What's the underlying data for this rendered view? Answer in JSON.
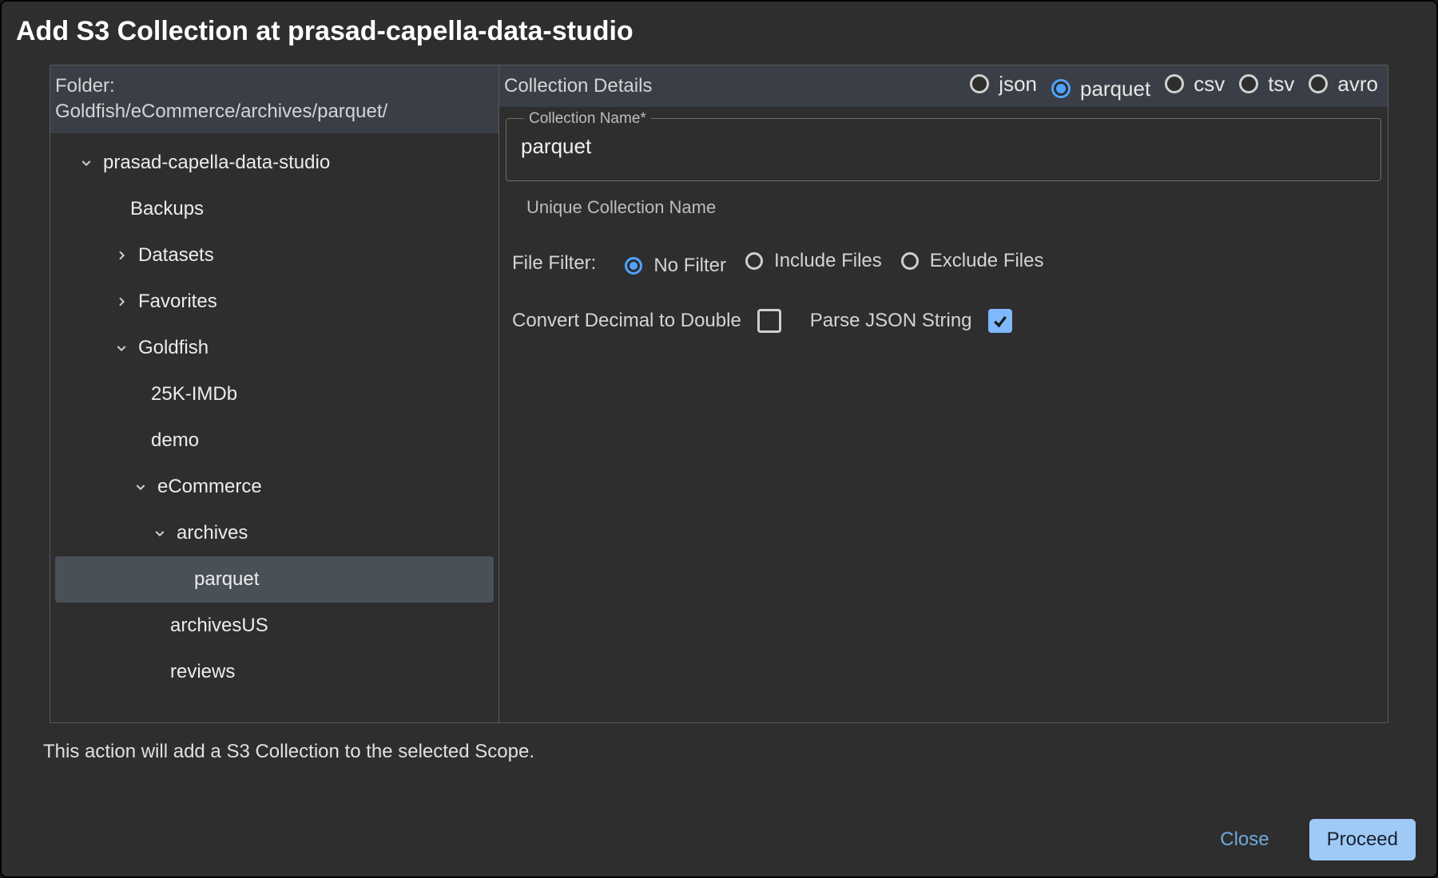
{
  "dialog": {
    "title": "Add S3 Collection at prasad-capella-data-studio",
    "footer_note": "This action will add a S3 Collection to the selected Scope.",
    "close_label": "Close",
    "proceed_label": "Proceed"
  },
  "left": {
    "folder_label": "Folder:",
    "folder_path": "Goldfish/eCommerce/archives/parquet/",
    "tree": [
      {
        "depth": 0,
        "chevron": "down",
        "label": "prasad-capella-data-studio",
        "selected": false
      },
      {
        "depth": 1,
        "chevron": "",
        "label": "Backups",
        "selected": false
      },
      {
        "depth": 1,
        "chevron": "right",
        "label": "Datasets",
        "selected": false
      },
      {
        "depth": 1,
        "chevron": "right",
        "label": "Favorites",
        "selected": false
      },
      {
        "depth": 1,
        "chevron": "down",
        "label": "Goldfish",
        "selected": false
      },
      {
        "depth": 2,
        "chevron": "",
        "label": "25K-IMDb",
        "selected": false
      },
      {
        "depth": 2,
        "chevron": "",
        "label": "demo",
        "selected": false
      },
      {
        "depth": 2,
        "chevron": "down",
        "label": "eCommerce",
        "selected": false
      },
      {
        "depth": 3,
        "chevron": "down",
        "label": "archives",
        "selected": false
      },
      {
        "depth": 4,
        "chevron": "",
        "label": "parquet",
        "selected": true
      },
      {
        "depth": 3,
        "chevron": "",
        "label": "archivesUS",
        "selected": false
      },
      {
        "depth": 3,
        "chevron": "",
        "label": "reviews",
        "selected": false
      }
    ]
  },
  "right": {
    "details_title": "Collection Details",
    "formats": [
      {
        "label": "json",
        "checked": false
      },
      {
        "label": "parquet",
        "checked": true
      },
      {
        "label": "csv",
        "checked": false
      },
      {
        "label": "tsv",
        "checked": false
      },
      {
        "label": "avro",
        "checked": false
      }
    ],
    "collection_name_label": "Collection Name*",
    "collection_name_value": "parquet",
    "collection_name_help": "Unique Collection Name",
    "file_filter_label": "File Filter:",
    "file_filter_options": [
      {
        "label": "No Filter",
        "checked": true
      },
      {
        "label": "Include Files",
        "checked": false
      },
      {
        "label": "Exclude Files",
        "checked": false
      }
    ],
    "checks": [
      {
        "label": "Convert Decimal to Double",
        "checked": false
      },
      {
        "label": "Parse JSON String",
        "checked": true
      }
    ]
  }
}
